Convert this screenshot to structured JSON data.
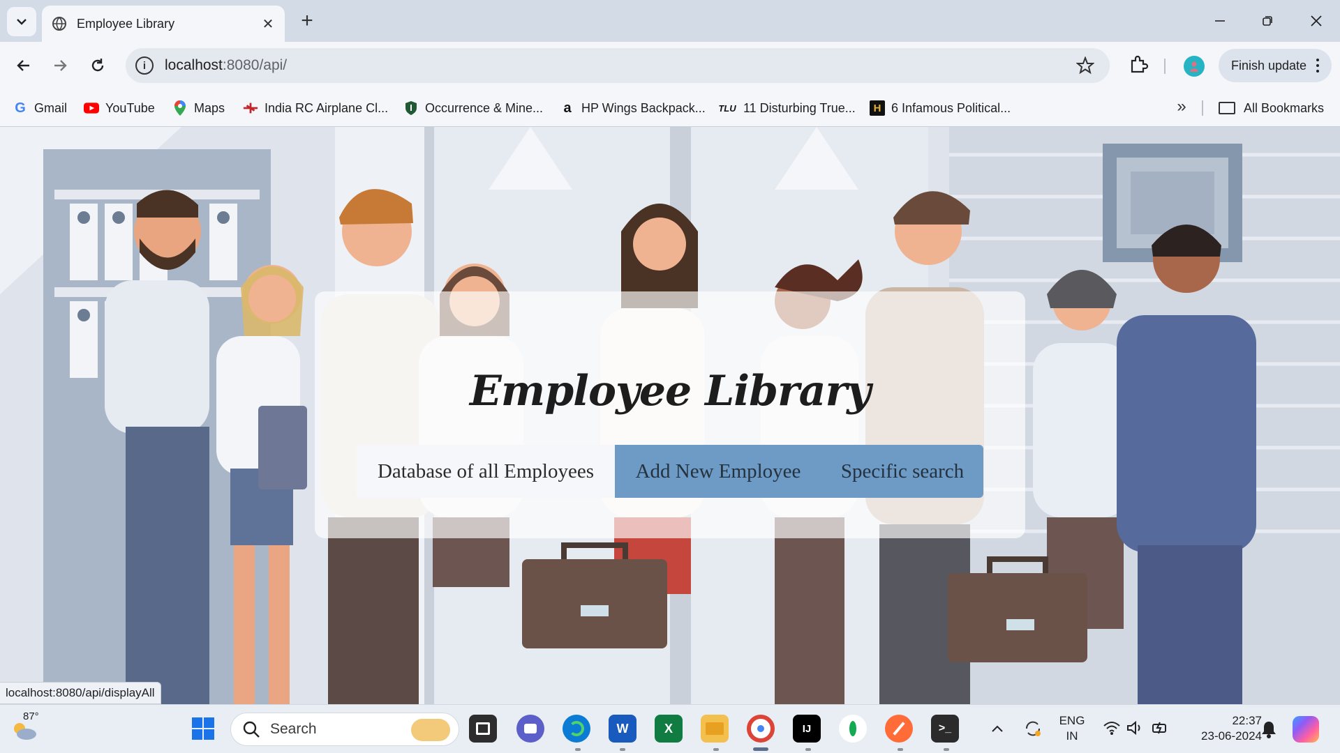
{
  "browser": {
    "tab_title": "Employee Library",
    "url_host": "localhost",
    "url_path": ":8080/api/",
    "finish_update": "Finish update",
    "bookmarks": [
      {
        "label": "Gmail",
        "icon": "gmail-icon"
      },
      {
        "label": "YouTube",
        "icon": "youtube-icon"
      },
      {
        "label": "Maps",
        "icon": "maps-icon"
      },
      {
        "label": "India RC Airplane Cl...",
        "icon": "airplane-icon"
      },
      {
        "label": "Occurrence & Mine...",
        "icon": "shield-icon"
      },
      {
        "label": "HP Wings Backpack...",
        "icon": "amazon-icon"
      },
      {
        "label": "11 Disturbing True...",
        "icon": "tlu-icon"
      },
      {
        "label": "6 Infamous Political...",
        "icon": "history-icon"
      }
    ],
    "all_bookmarks": "All Bookmarks",
    "status_url": "localhost:8080/api/displayAll"
  },
  "page": {
    "heading": "Employee Library",
    "buttons": {
      "database": "Database of all Employees",
      "add": "Add New Employee",
      "search": "Specific search"
    },
    "colors": {
      "button_active_bg": "#f6f7fb",
      "button_bg": "#6e9bc6",
      "card_bg": "rgba(255,255,255,0.66)"
    }
  },
  "taskbar": {
    "weather_temp": "87°",
    "search_placeholder": "Search",
    "lang_line1": "ENG",
    "lang_line2": "IN",
    "time": "22:37",
    "date": "23-06-2024"
  }
}
